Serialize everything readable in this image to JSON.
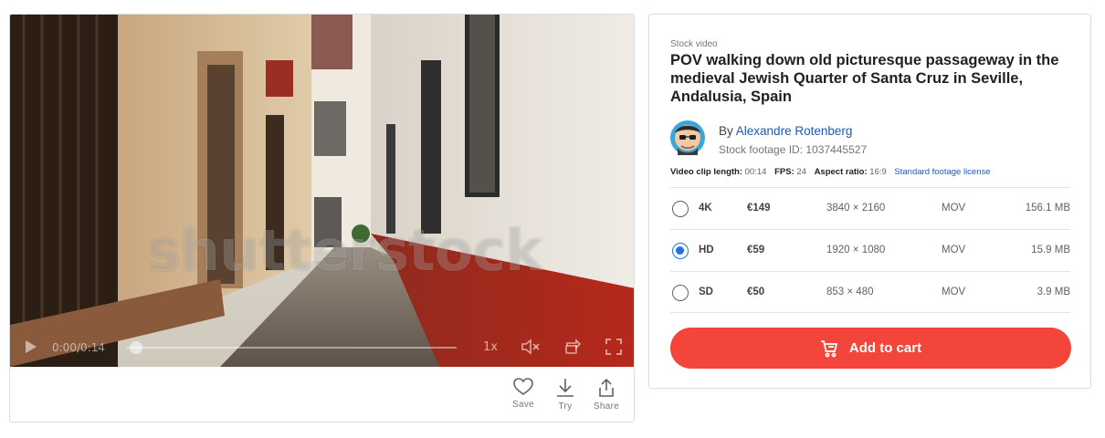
{
  "player": {
    "watermark": "shutterstock",
    "time": "0:00/0:14",
    "speed": "1x",
    "progress": 0.03
  },
  "actions": {
    "save_label": "Save",
    "try_label": "Try",
    "share_label": "Share"
  },
  "details": {
    "eyebrow": "Stock video",
    "title": "POV walking down old picturesque passageway in the medieval Jewish Quarter of Santa Cruz in Seville, Andalusia, Spain",
    "by_prefix": "By",
    "author": "Alexandre Rotenberg",
    "footage_id": "Stock footage ID: 1037445527",
    "meta": {
      "length_label": "Video clip length:",
      "length_value": "00:14",
      "fps_label": "FPS:",
      "fps_value": "24",
      "aspect_label": "Aspect ratio:",
      "aspect_value": "16:9",
      "license_link": "Standard footage license"
    }
  },
  "options": [
    {
      "quality": "4K",
      "price": "€149",
      "resolution": "3840 × 2160",
      "format": "MOV",
      "size": "156.1 MB",
      "selected": false
    },
    {
      "quality": "HD",
      "price": "€59",
      "resolution": "1920 × 1080",
      "format": "MOV",
      "size": "15.9 MB",
      "selected": true
    },
    {
      "quality": "SD",
      "price": "€50",
      "resolution": "853 × 480",
      "format": "MOV",
      "size": "3.9 MB",
      "selected": false
    }
  ],
  "cart": {
    "label": "Add to cart",
    "color": "#f3453a"
  },
  "colors": {
    "link": "#1a5bbd",
    "radio_selected": "#1a73e8"
  },
  "icons": [
    "play-icon",
    "mute-icon",
    "loop-icon",
    "fullscreen-icon",
    "heart-icon",
    "download-icon",
    "share-icon",
    "cart-icon"
  ]
}
